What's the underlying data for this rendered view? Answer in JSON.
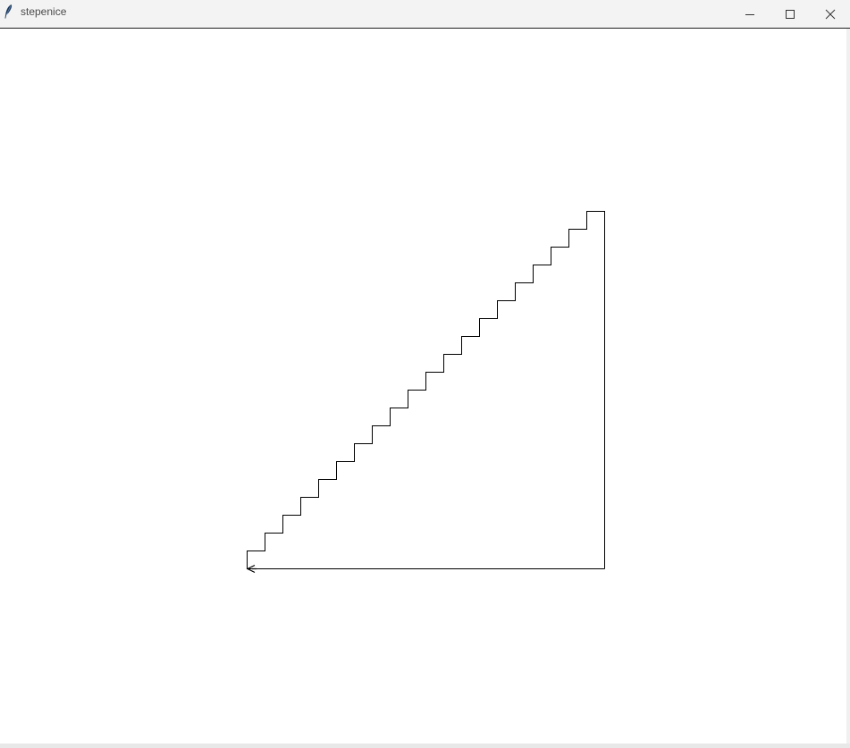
{
  "window": {
    "title": "stepenice",
    "controls": {
      "minimize": "minimize-icon",
      "maximize": "maximize-icon",
      "close": "close-icon"
    }
  },
  "drawing": {
    "stroke_color": "#000000",
    "background_color": "#ffffff",
    "stair_steps": 20,
    "arrowhead": "arrow-left-icon"
  }
}
